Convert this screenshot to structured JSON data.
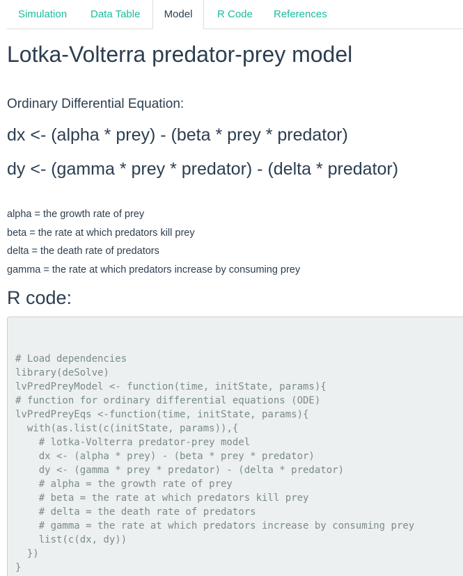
{
  "tabs": [
    {
      "label": "Simulation",
      "active": false
    },
    {
      "label": "Data Table",
      "active": false
    },
    {
      "label": "Model",
      "active": true
    },
    {
      "label": "R Code",
      "active": false
    },
    {
      "label": "References",
      "active": false
    }
  ],
  "title": "Lotka-Volterra predator-prey model",
  "ode_label": "Ordinary Differential Equation:",
  "equations": [
    "dx <- (alpha * prey) - (beta * prey * predator)",
    "dy <- (gamma * prey * predator) - (delta * predator)"
  ],
  "definitions": [
    "alpha = the growth rate of prey",
    "beta = the rate at which predators kill prey",
    "delta = the death rate of predators",
    "gamma = the rate at which predators increase by consuming prey"
  ],
  "r_code_heading": "R code:",
  "code_lines": [
    "# Load dependencies",
    "library(deSolve)",
    "lvPredPreyModel <- function(time, initState, params){",
    "# function for ordinary differential equations (ODE)",
    "lvPredPreyEqs <-function(time, initState, params){",
    "  with(as.list(c(initState, params)),{",
    "    # lotka-Volterra predator-prey model",
    "    dx <- (alpha * prey) - (beta * prey * predator)",
    "    dy <- (gamma * prey * predator) - (delta * predator)",
    "    # alpha = the growth rate of prey",
    "    # beta = the rate at which predators kill prey",
    "    # delta = the death rate of predators",
    "    # gamma = the rate at which predators increase by consuming prey",
    "    list(c(dx, dy))",
    "  })",
    "}"
  ],
  "colors": {
    "accent": "#18bc9c",
    "heading": "#2c3e50",
    "code_bg": "#ecf0f1",
    "code_text": "#7b8a8b"
  }
}
